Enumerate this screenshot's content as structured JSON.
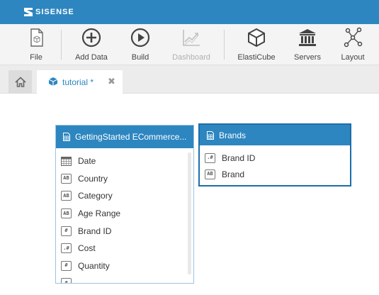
{
  "app": {
    "logo_text": "SISENSE"
  },
  "toolbar": {
    "items": [
      {
        "label": "File",
        "icon": "file-icon",
        "enabled": true
      },
      {
        "label": "Add Data",
        "icon": "add-circle-icon",
        "enabled": true
      },
      {
        "label": "Build",
        "icon": "play-circle-icon",
        "enabled": true
      },
      {
        "label": "Dashboard",
        "icon": "chart-icon",
        "enabled": false
      },
      {
        "label": "ElastiCube",
        "icon": "cube-icon",
        "enabled": true
      },
      {
        "label": "Servers",
        "icon": "building-icon",
        "enabled": true
      },
      {
        "label": "Layout",
        "icon": "network-icon",
        "enabled": true
      }
    ]
  },
  "tabs": {
    "home_icon": "home-icon",
    "active": {
      "label": "tutorial *",
      "icon": "cube-icon",
      "close_icon": "close-icon"
    }
  },
  "tables": [
    {
      "title": "GettingStarted ECommerce...",
      "icon": "table-icon",
      "fields": [
        {
          "name": "Date",
          "type": "date"
        },
        {
          "name": "Country",
          "type": "text"
        },
        {
          "name": "Category",
          "type": "text"
        },
        {
          "name": "Age Range",
          "type": "text"
        },
        {
          "name": "Brand ID",
          "type": "int"
        },
        {
          "name": "Cost",
          "type": "decimal"
        },
        {
          "name": "Quantity",
          "type": "int"
        },
        {
          "name": "",
          "type": "int"
        }
      ]
    },
    {
      "title": "Brands",
      "icon": "table-icon",
      "fields": [
        {
          "name": "Brand ID",
          "type": "decimal"
        },
        {
          "name": "Brand",
          "type": "text"
        }
      ]
    }
  ],
  "field_type_glyphs": {
    "text": "AB",
    "int": "#",
    "decimal": ".#"
  },
  "colors": {
    "brand": "#2d86c0",
    "selected_border": "#1c6fa8"
  }
}
